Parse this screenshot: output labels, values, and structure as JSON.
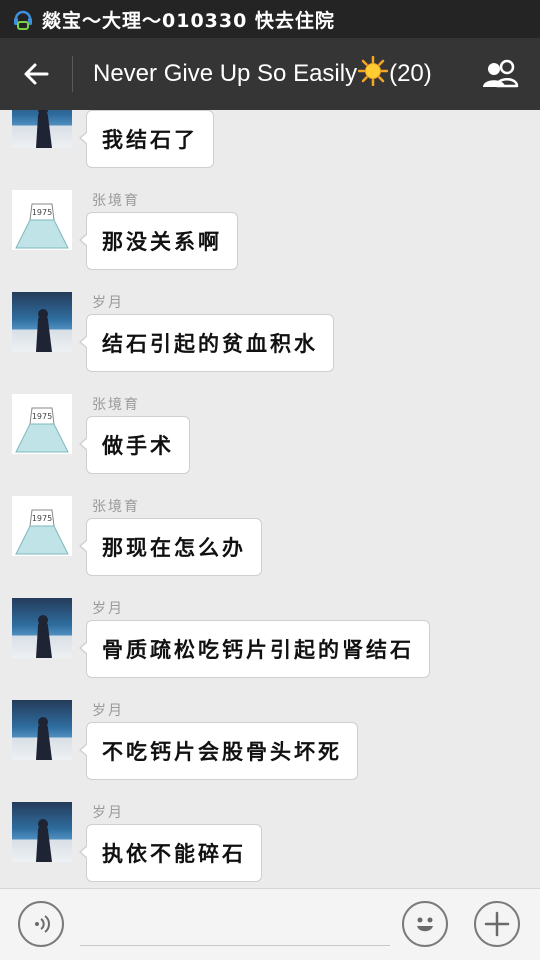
{
  "status_bar": {
    "text": "燚宝～大理～010330 快去住院",
    "icon": "notification-chat-icon"
  },
  "header": {
    "title_prefix": "Never Give Up So Easily",
    "title_emoji": "☀️",
    "title_count": "(20)",
    "back_icon": "back-arrow-icon",
    "group_icon": "group-members-icon"
  },
  "messages": [
    {
      "sender": "",
      "text": "我结石了",
      "avatar": "sea"
    },
    {
      "sender": "张境育",
      "text": "那没关系啊",
      "avatar": "girl"
    },
    {
      "sender": "岁月",
      "text": "结石引起的贫血积水",
      "avatar": "sea"
    },
    {
      "sender": "张境育",
      "text": "做手术",
      "avatar": "girl"
    },
    {
      "sender": "张境育",
      "text": "那现在怎么办",
      "avatar": "girl"
    },
    {
      "sender": "岁月",
      "text": "骨质疏松吃钙片引起的肾结石",
      "avatar": "sea"
    },
    {
      "sender": "岁月",
      "text": "不吃钙片会股骨头坏死",
      "avatar": "sea"
    },
    {
      "sender": "岁月",
      "text": "执依不能碎石",
      "avatar": "sea"
    }
  ],
  "avatar_girl_label": "1975",
  "input_bar": {
    "voice_icon": "voice-mode-icon",
    "emoji_icon": "emoji-smiley-icon",
    "more_icon": "plus-icon"
  },
  "colors": {
    "status_bar": "#242424",
    "action_bar": "#353535",
    "chat_bg": "#ebebeb",
    "bubble": "#ffffff"
  }
}
